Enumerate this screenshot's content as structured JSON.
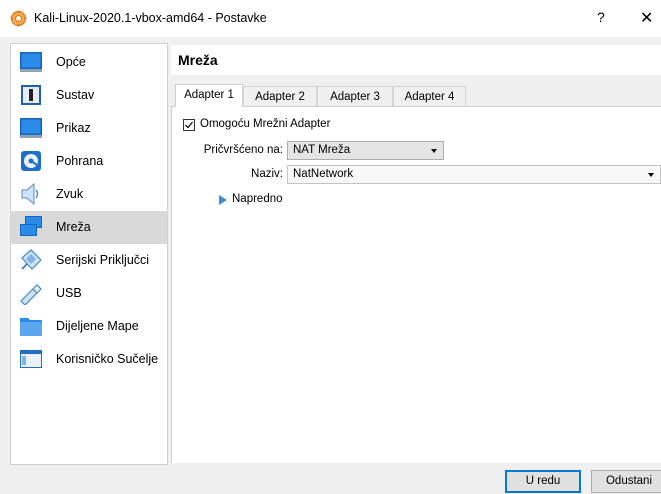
{
  "window": {
    "title": "Kali-Linux-2020.1-vbox-amd64 - Postavke",
    "help_label": "?",
    "close_label": "✕"
  },
  "sidebar": {
    "items": [
      {
        "label": "Opće",
        "icon": "general-monitor-icon"
      },
      {
        "label": "Sustav",
        "icon": "system-board-icon"
      },
      {
        "label": "Prikaz",
        "icon": "display-monitor-icon"
      },
      {
        "label": "Pohrana",
        "icon": "storage-disk-icon"
      },
      {
        "label": "Zvuk",
        "icon": "speaker-icon"
      },
      {
        "label": "Mreža",
        "icon": "network-icon",
        "selected": true
      },
      {
        "label": "Serijski Priključci",
        "icon": "serial-port-icon"
      },
      {
        "label": "USB",
        "icon": "usb-icon"
      },
      {
        "label": "Dijeljene Mape",
        "icon": "shared-folder-icon"
      },
      {
        "label": "Korisničko Sučelje",
        "icon": "user-interface-icon"
      }
    ]
  },
  "content": {
    "title": "Mreža",
    "tabs": [
      "Adapter 1",
      "Adapter 2",
      "Adapter 3",
      "Adapter 4"
    ],
    "active_tab": 0,
    "enable_adapter": {
      "label": "Omogoću Mrežni Adapter",
      "checked": true
    },
    "attached_to": {
      "label": "Pričvršćeno na:",
      "value": "NAT Mreža"
    },
    "name": {
      "label": "Naziv:",
      "value": "NatNetwork"
    },
    "advanced_label": "Napredno"
  },
  "buttons": {
    "ok": "U redu",
    "cancel": "Odustani"
  },
  "colors": {
    "accent": "#0078d7",
    "selection": "#d9d9d9",
    "expander": "#3b8fd9"
  }
}
